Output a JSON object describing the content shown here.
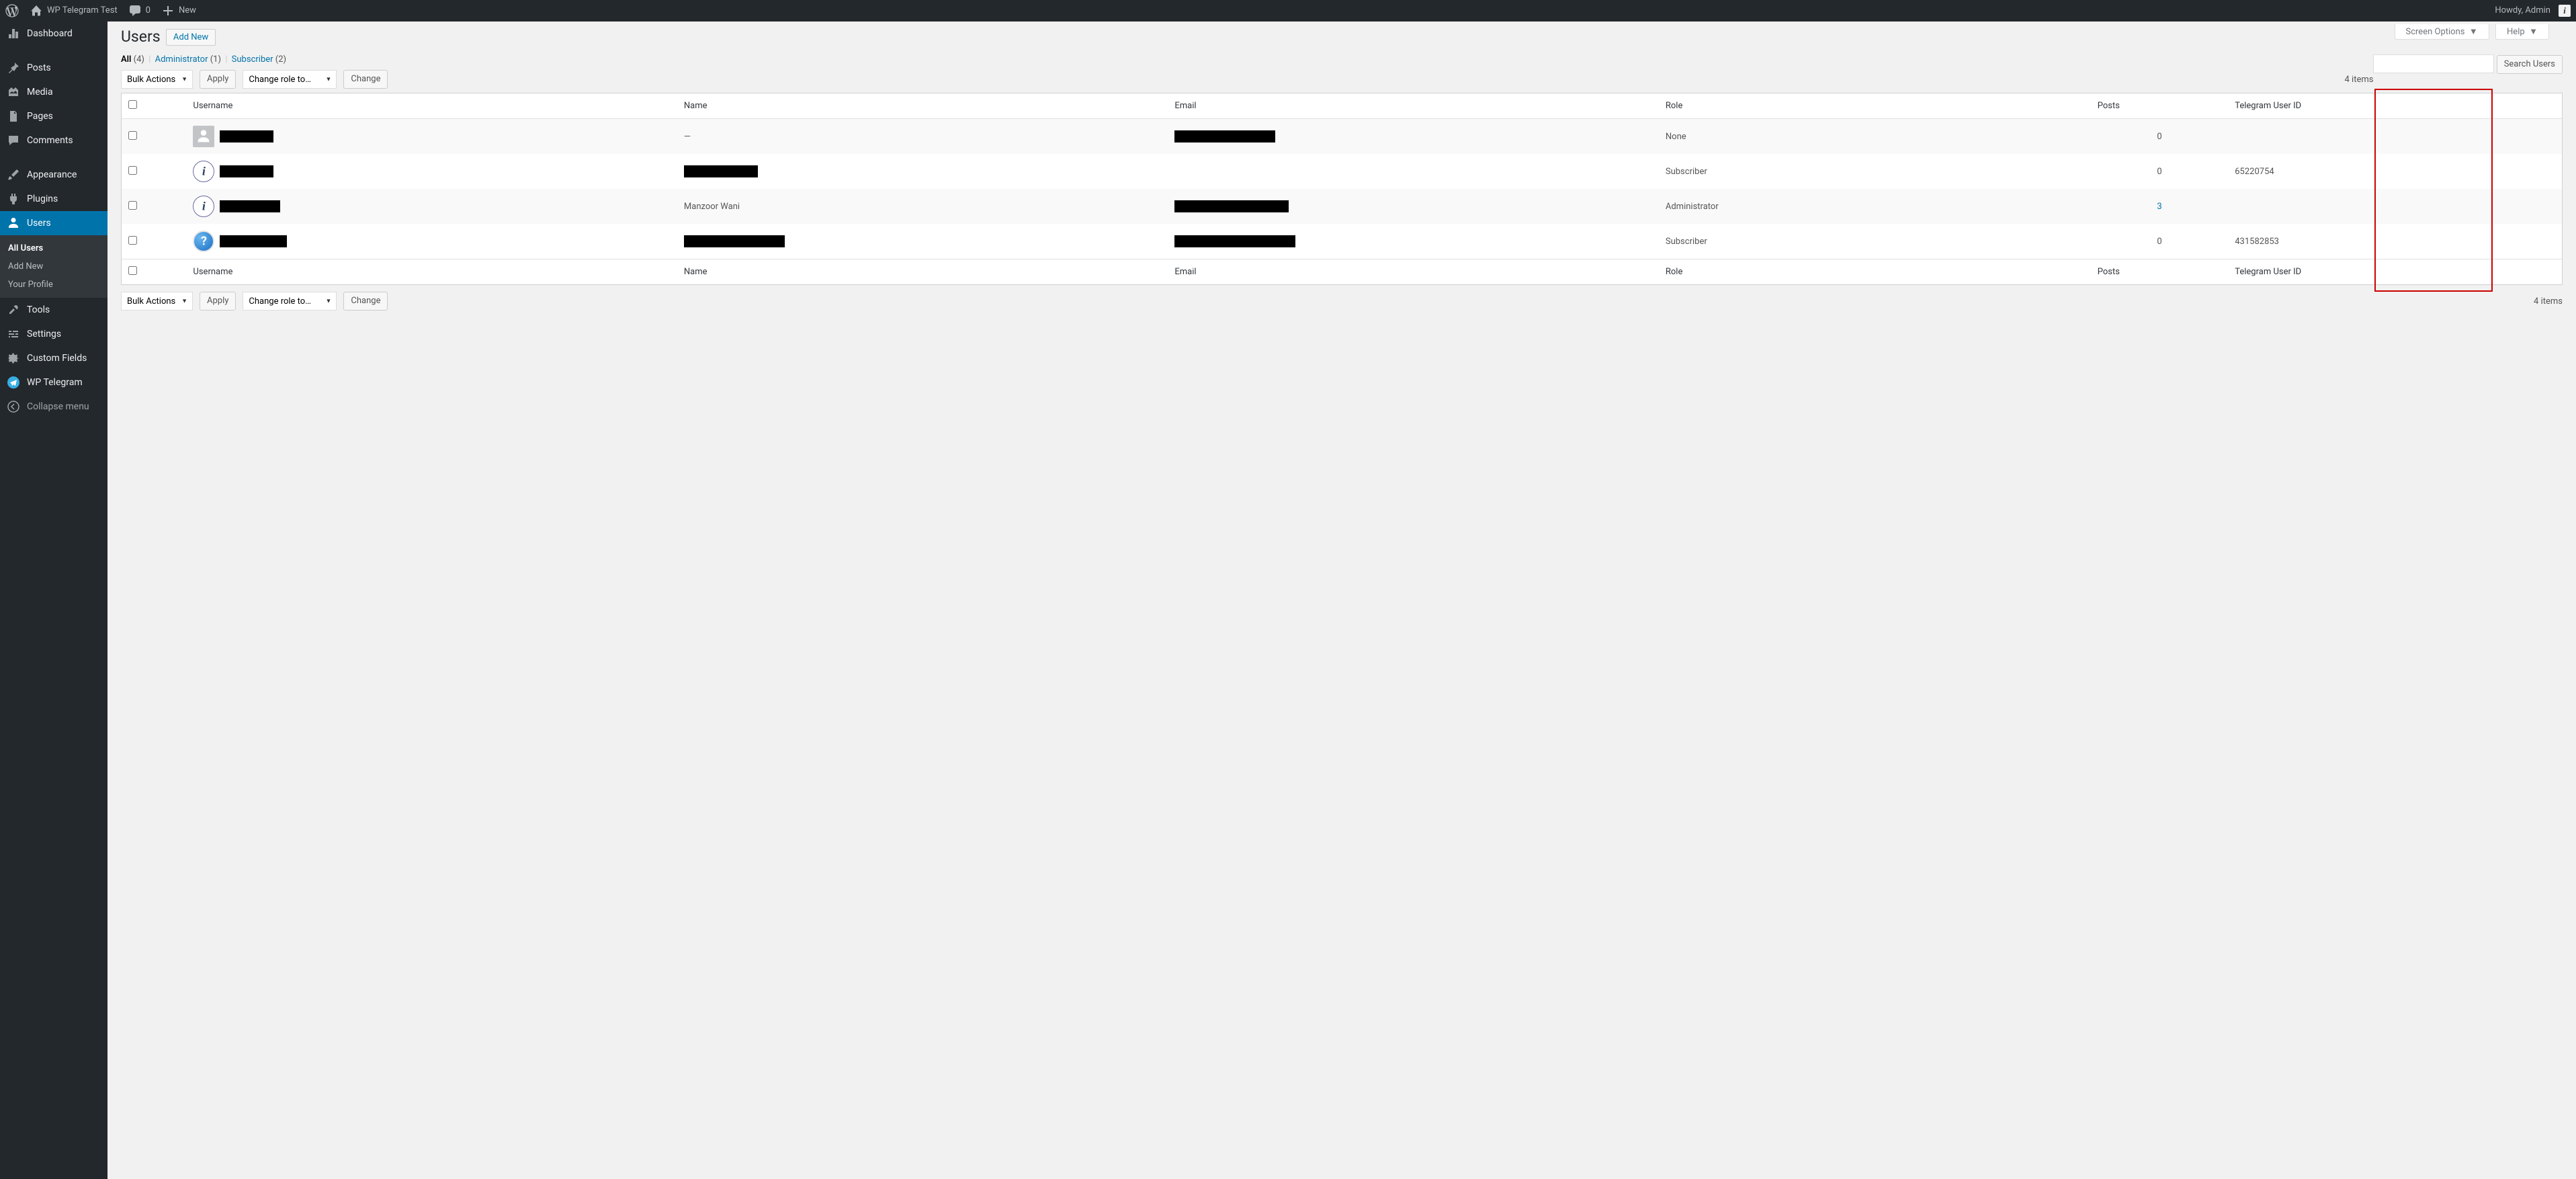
{
  "adminbar": {
    "site_title": "WP Telegram Test",
    "comments": "0",
    "new_label": "New",
    "howdy": "Howdy, Admin"
  },
  "menu": {
    "dashboard": "Dashboard",
    "posts": "Posts",
    "media": "Media",
    "pages": "Pages",
    "comments": "Comments",
    "appearance": "Appearance",
    "plugins": "Plugins",
    "users": "Users",
    "tools": "Tools",
    "settings": "Settings",
    "custom_fields": "Custom Fields",
    "wp_telegram": "WP Telegram",
    "collapse": "Collapse menu"
  },
  "submenu": {
    "all_users": "All Users",
    "add_new": "Add New",
    "your_profile": "Your Profile"
  },
  "screen_meta": {
    "screen_options": "Screen Options",
    "help": "Help"
  },
  "header": {
    "title": "Users",
    "add_new": "Add New"
  },
  "filters": {
    "all_label": "All",
    "all_count": "(4)",
    "admin_label": "Administrator",
    "admin_count": "(1)",
    "subscriber_label": "Subscriber",
    "subscriber_count": "(2)"
  },
  "tablenav": {
    "bulk_actions": "Bulk Actions",
    "apply": "Apply",
    "change_role": "Change role to…",
    "change": "Change",
    "items_count": "4 items"
  },
  "search": {
    "button": "Search Users"
  },
  "columns": {
    "username": "Username",
    "name": "Name",
    "email": "Email",
    "role": "Role",
    "posts": "Posts",
    "telegram": "Telegram User ID"
  },
  "rows": [
    {
      "avatar": "default",
      "username_redacted": true,
      "name": "—",
      "name_redacted": false,
      "email_redacted": true,
      "role": "None",
      "posts": "0",
      "posts_link": false,
      "telegram": ""
    },
    {
      "avatar": "clock",
      "username_redacted": true,
      "name": "",
      "name_redacted": true,
      "email_redacted": false,
      "role": "Subscriber",
      "posts": "0",
      "posts_link": false,
      "telegram": "65220754"
    },
    {
      "avatar": "clock",
      "username_redacted": true,
      "name": "Manzoor Wani",
      "name_redacted": false,
      "email_redacted": true,
      "role": "Administrator",
      "posts": "3",
      "posts_link": true,
      "telegram": ""
    },
    {
      "avatar": "question",
      "username_redacted": true,
      "name": "",
      "name_redacted": true,
      "email_redacted": true,
      "role": "Subscriber",
      "posts": "0",
      "posts_link": false,
      "telegram": "431582853"
    }
  ]
}
